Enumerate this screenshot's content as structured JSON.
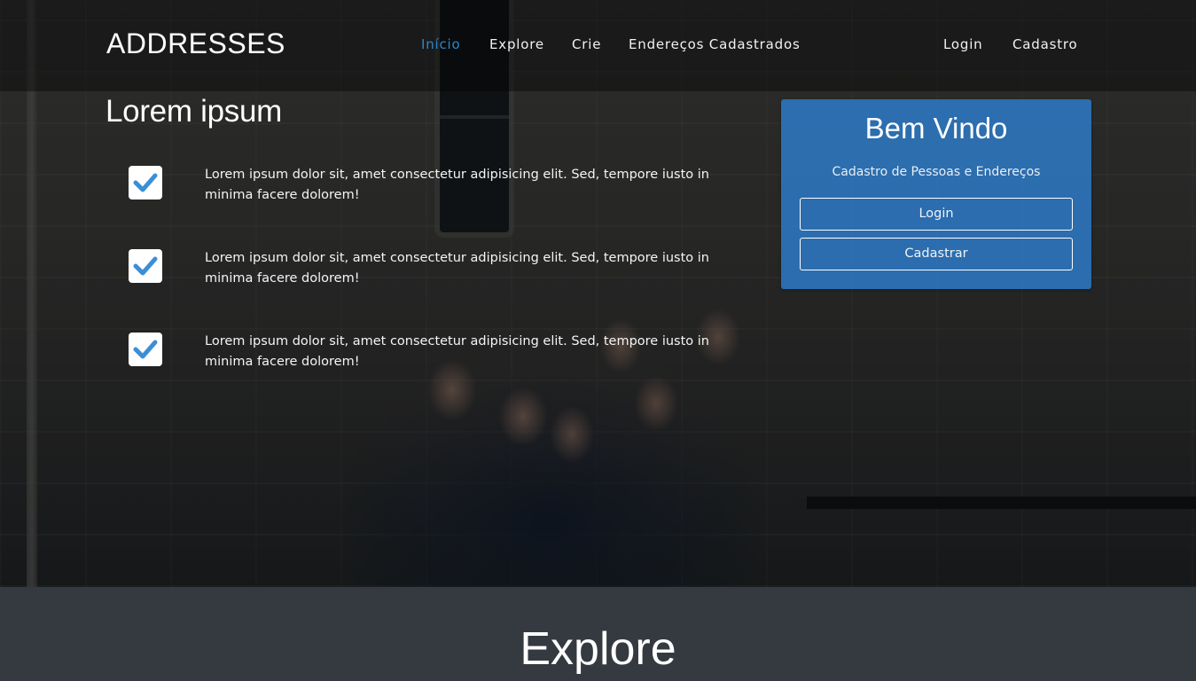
{
  "brand": {
    "text": "ADDRESSES"
  },
  "nav": {
    "items": [
      {
        "label": "Início",
        "active": true
      },
      {
        "label": "Explore",
        "active": false
      },
      {
        "label": "Crie",
        "active": false
      },
      {
        "label": "Endereços Cadastrados",
        "active": false
      }
    ],
    "right_items": [
      {
        "label": "Login"
      },
      {
        "label": "Cadastro"
      }
    ]
  },
  "hero": {
    "title": "Lorem ipsum",
    "features": [
      {
        "text": "Lorem ipsum dolor sit, amet consectetur adipisicing elit. Sed, tempore iusto in minima facere dolorem!",
        "icon": "check-icon"
      },
      {
        "text": "Lorem ipsum dolor sit, amet consectetur adipisicing elit. Sed, tempore iusto in minima facere dolorem!",
        "icon": "check-icon"
      },
      {
        "text": "Lorem ipsum dolor sit, amet consectetur adipisicing elit. Sed, tempore iusto in minima facere dolorem!",
        "icon": "check-icon"
      }
    ]
  },
  "welcome_card": {
    "title": "Bem Vindo",
    "subtitle": "Cadastro de Pessoas e Endereços",
    "login_label": "Login",
    "register_label": "Cadastrar"
  },
  "explore": {
    "title": "Explore"
  },
  "colors": {
    "accent": "#2f86c8",
    "card": "#2c78c1",
    "section_bg": "#343a40",
    "check": "#3a8fd6"
  }
}
